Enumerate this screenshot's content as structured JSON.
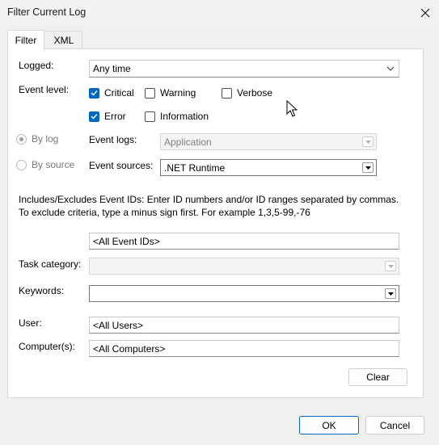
{
  "window": {
    "title": "Filter Current Log",
    "close_icon": "close-icon"
  },
  "tabs": [
    {
      "label": "Filter",
      "active": true
    },
    {
      "label": "XML",
      "active": false
    }
  ],
  "filter": {
    "logged": {
      "label": "Logged:",
      "value": "Any time"
    },
    "event_level": {
      "label": "Event level:",
      "levels": [
        {
          "label": "Critical",
          "checked": true
        },
        {
          "label": "Warning",
          "checked": false
        },
        {
          "label": "Verbose",
          "checked": false
        },
        {
          "label": "Error",
          "checked": true
        },
        {
          "label": "Information",
          "checked": false
        }
      ]
    },
    "by_log": {
      "label": "By log",
      "selected": false
    },
    "by_source": {
      "label": "By source",
      "selected": false
    },
    "event_logs": {
      "label": "Event logs:",
      "value": "Application",
      "disabled": true
    },
    "event_sources": {
      "label": "Event sources:",
      "value": ".NET Runtime"
    },
    "event_ids": {
      "description": "Includes/Excludes Event IDs: Enter ID numbers and/or ID ranges separated by commas. To exclude criteria, type a minus sign first. For example 1,3,5-99,-76",
      "value": "<All Event IDs>"
    },
    "task_category": {
      "label": "Task category:",
      "value": "",
      "disabled": true
    },
    "keywords": {
      "label": "Keywords:",
      "value": ""
    },
    "user": {
      "label": "User:",
      "value": "<All Users>"
    },
    "computers": {
      "label": "Computer(s):",
      "value": "<All Computers>"
    },
    "clear_label": "Clear"
  },
  "footer": {
    "ok_label": "OK",
    "cancel_label": "Cancel"
  },
  "colors": {
    "accent": "#0067c0"
  }
}
